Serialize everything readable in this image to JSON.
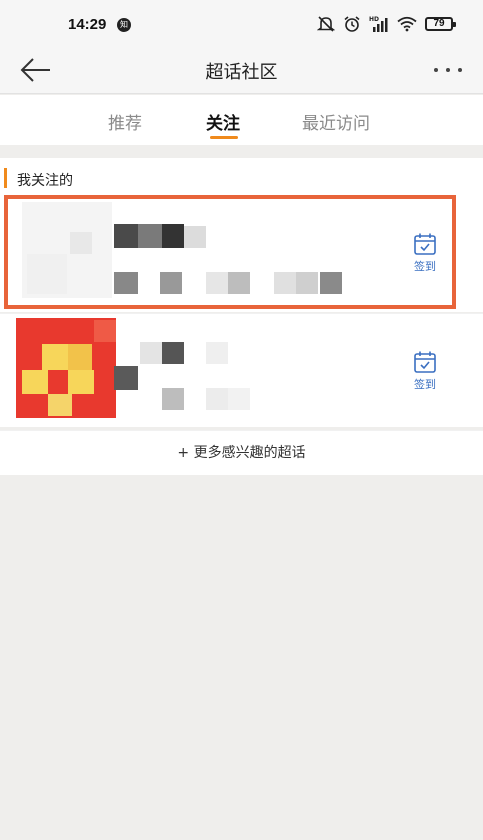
{
  "status_bar": {
    "time": "14:29",
    "notification_badge": "知",
    "battery_level": "79"
  },
  "navbar": {
    "title": "超话社区"
  },
  "tabs": [
    {
      "label": "推荐",
      "active": false
    },
    {
      "label": "关注",
      "active": true
    },
    {
      "label": "最近访问",
      "active": false
    }
  ],
  "section": {
    "title": "我关注的"
  },
  "followed_topics": [
    {
      "name": "",
      "description": "",
      "checkin_label": "签到",
      "highlighted": true
    },
    {
      "name": "",
      "description": "",
      "checkin_label": "签到",
      "highlighted": false
    }
  ],
  "more_topics_label": "+ 更多感兴趣的超话",
  "colors": {
    "accent": "#f08a1c",
    "highlight_border": "#e8643a",
    "checkin_blue": "#3a6fc1"
  }
}
